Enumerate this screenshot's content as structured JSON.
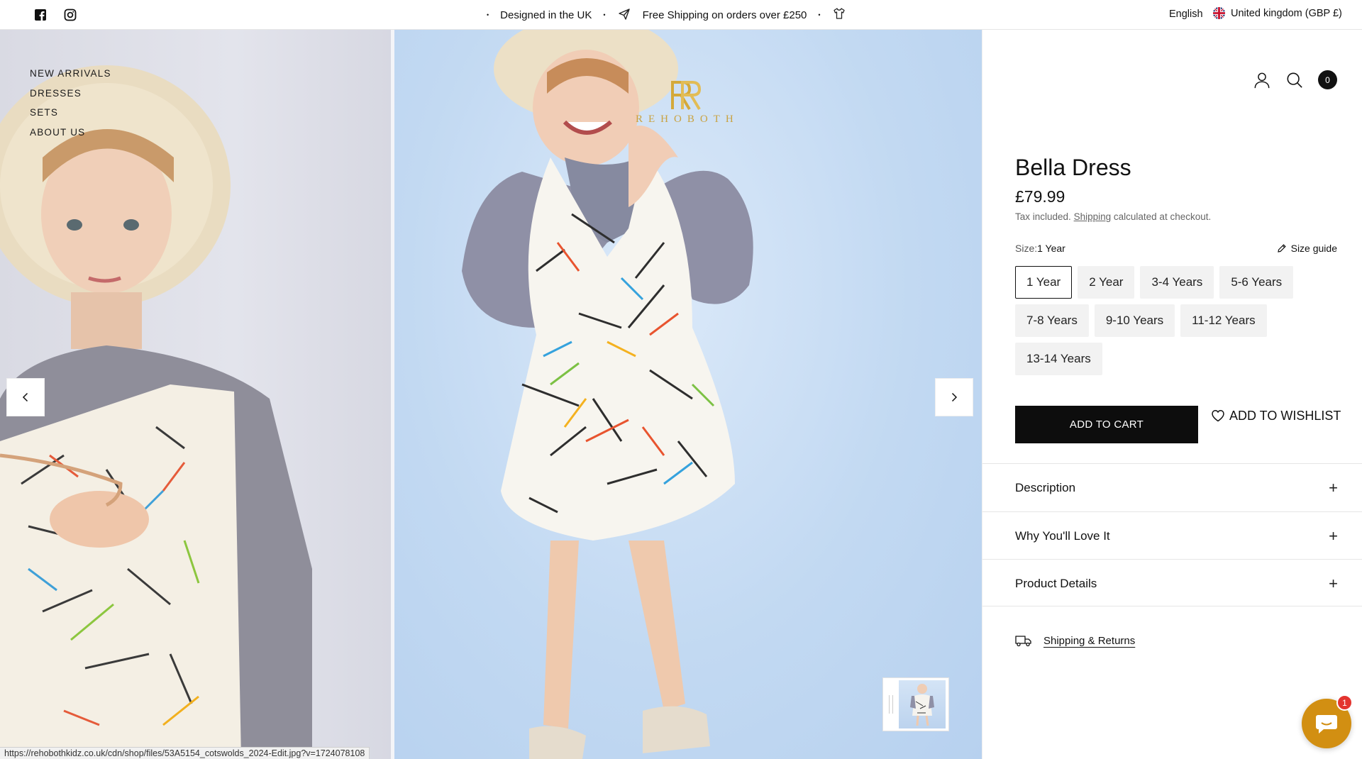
{
  "announcement": {
    "items": [
      "Designed in the UK",
      "Free Shipping on orders over £250"
    ],
    "separator": "•",
    "language": "English",
    "country": "United kingdom (GBP £)"
  },
  "nav": {
    "items": [
      "NEW ARRIVALS",
      "DRESSES",
      "SETS",
      "ABOUT US"
    ]
  },
  "brand": {
    "wordmark": "REHOBOTH"
  },
  "header": {
    "cart_count": "0"
  },
  "product": {
    "title": "Bella Dress",
    "price": "£79.99",
    "tax_prefix": "Tax included.",
    "tax_link": "Shipping",
    "tax_suffix": "calculated at checkout.",
    "size_label": "Size:",
    "size_value": "1 Year",
    "size_guide": "Size guide",
    "sizes": [
      "1 Year",
      "2 Year",
      "3-4 Years",
      "5-6 Years",
      "7-8 Years",
      "9-10 Years",
      "11-12 Years",
      "13-14 Years"
    ],
    "selected_size": "1 Year",
    "add_to_cart": "ADD TO CART",
    "add_to_wishlist": "ADD TO WISHLIST"
  },
  "accordions": [
    "Description",
    "Why You'll Love It",
    "Product Details"
  ],
  "shipping_returns": "Shipping & Returns",
  "status_url": "https://rehobothkidz.co.uk/cdn/shop/files/53A5154_cotswolds_2024-Edit.jpg?v=1724078108",
  "chat": {
    "badge": "1"
  },
  "colors": {
    "accent": "#0d0d0d",
    "gold": "#c9a240",
    "chat": "#d28f12",
    "badge": "#e3342f"
  }
}
